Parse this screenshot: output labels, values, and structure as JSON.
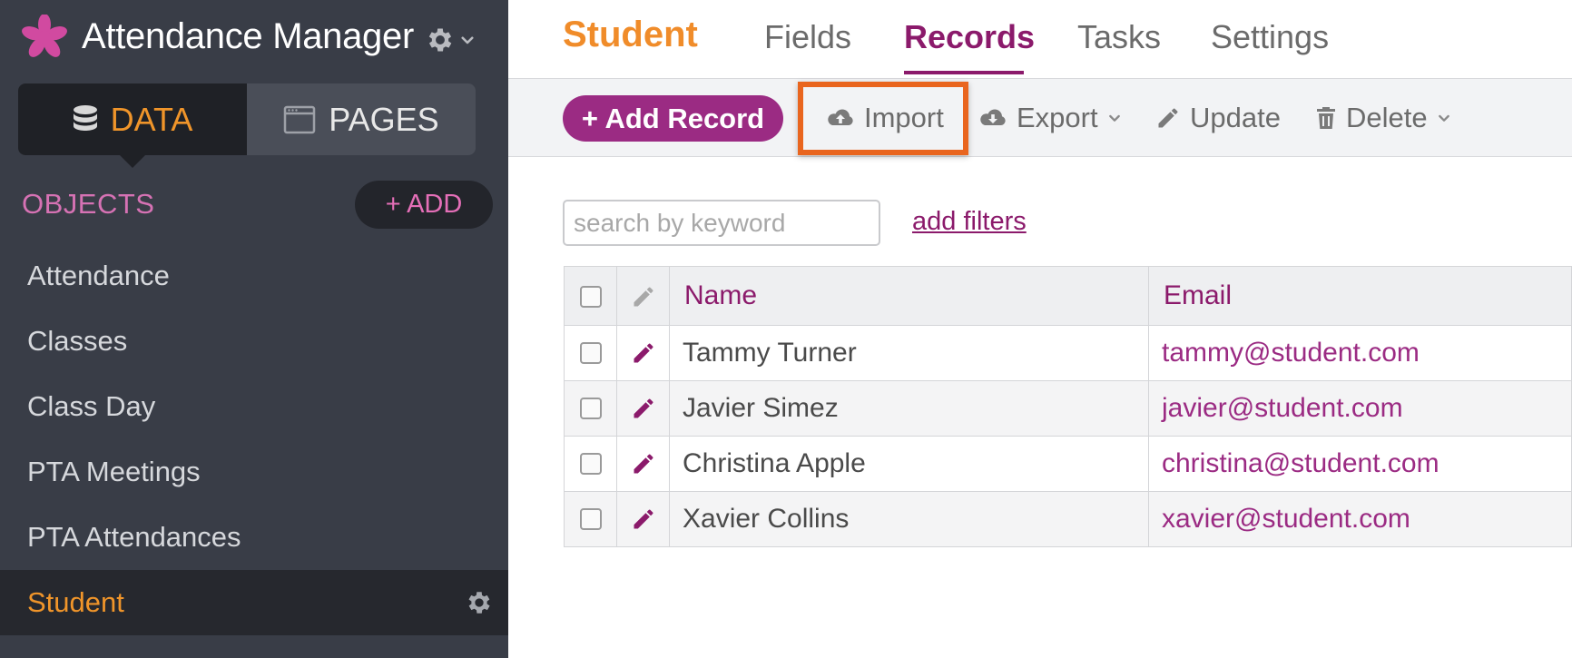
{
  "app": {
    "title": "Attendance Manager",
    "colors": {
      "sidebar": "#393d47",
      "accent_orange": "#f0952a",
      "accent_purple": "#9b2b83",
      "accent_pink": "#e56fb8",
      "highlight": "#e9651e"
    }
  },
  "mode_switch": {
    "data_label": "DATA",
    "pages_label": "PAGES",
    "data_icon": "database-icon",
    "pages_icon": "browser-window-icon"
  },
  "sidebar": {
    "objects_heading": "OBJECTS",
    "add_label": "+ ADD",
    "items": [
      {
        "label": "Attendance"
      },
      {
        "label": "Classes"
      },
      {
        "label": "Class Day"
      },
      {
        "label": "PTA Meetings"
      },
      {
        "label": "PTA Attendances"
      },
      {
        "label": "Student",
        "active": true
      }
    ]
  },
  "main": {
    "object_title": "Student",
    "tabs": [
      {
        "label": "Fields"
      },
      {
        "label": "Records",
        "active": true
      },
      {
        "label": "Tasks"
      },
      {
        "label": "Settings"
      }
    ]
  },
  "toolbar": {
    "add_record_label": "+ Add Record",
    "import_label": "Import",
    "export_label": "Export",
    "update_label": "Update",
    "delete_label": "Delete"
  },
  "search": {
    "placeholder": "search by keyword",
    "value": "",
    "add_filters_label": "add filters"
  },
  "table": {
    "columns": [
      "Name",
      "Email"
    ],
    "rows": [
      {
        "name": "Tammy Turner",
        "email": "tammy@student.com"
      },
      {
        "name": "Javier Simez",
        "email": "javier@student.com"
      },
      {
        "name": "Christina Apple",
        "email": "christina@student.com"
      },
      {
        "name": "Xavier Collins",
        "email": "xavier@student.com"
      }
    ]
  }
}
